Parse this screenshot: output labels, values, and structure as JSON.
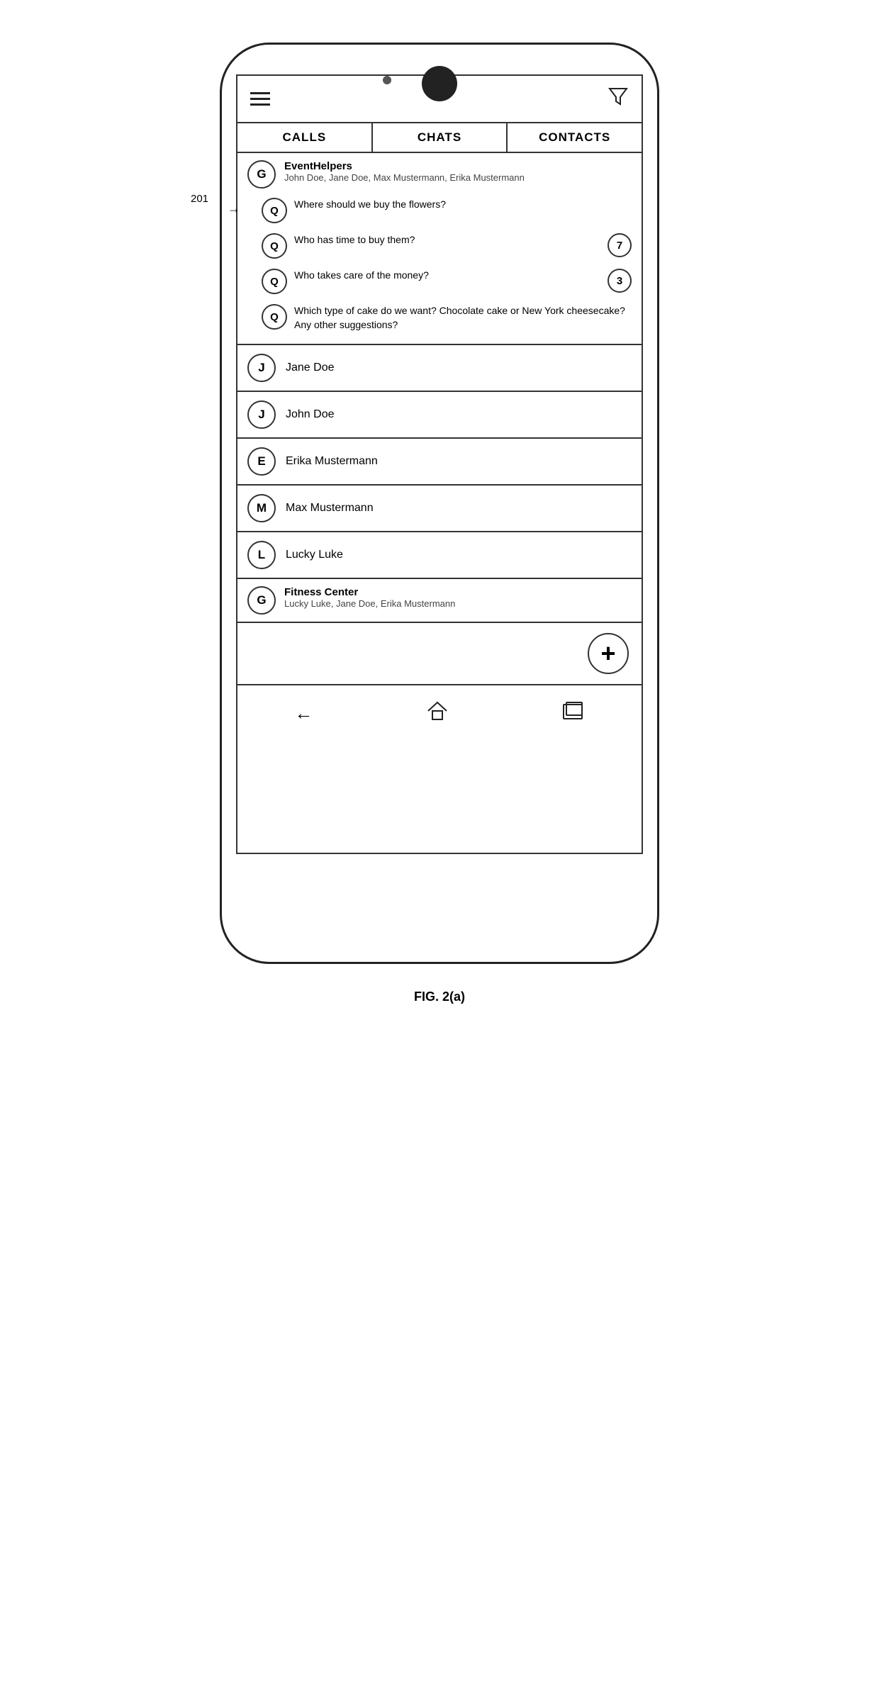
{
  "header": {
    "hamburger_label": "menu",
    "filter_label": "filter"
  },
  "tabs": [
    {
      "label": "CALLS",
      "active": false
    },
    {
      "label": "CHATS",
      "active": true
    },
    {
      "label": "CONTACTS",
      "active": false
    }
  ],
  "group_chat": {
    "avatar_letter": "G",
    "name": "EventHelpers",
    "members": "John Doe, Jane Doe, Max Mustermann, Erika Mustermann",
    "threads": [
      {
        "id": "thread-1",
        "avatar_letter": "Q",
        "message": "Where should we buy the flowers?",
        "unread": null,
        "annotation": "201"
      },
      {
        "id": "thread-2",
        "avatar_letter": "Q",
        "message": "Who has time to buy them?",
        "unread": "7"
      },
      {
        "id": "thread-3",
        "avatar_letter": "Q",
        "message": "Who takes care of the money?",
        "unread": "3"
      },
      {
        "id": "thread-4",
        "avatar_letter": "Q",
        "message": "Which type of cake do we want? Chocolate cake or New York cheesecake? Any other suggestions?",
        "unread": null
      }
    ]
  },
  "contacts": [
    {
      "avatar_letter": "J",
      "name": "Jane Doe"
    },
    {
      "avatar_letter": "J",
      "name": "John Doe"
    },
    {
      "avatar_letter": "E",
      "name": "Erika Mustermann"
    },
    {
      "avatar_letter": "M",
      "name": "Max Mustermann"
    },
    {
      "avatar_letter": "L",
      "name": "Lucky Luke"
    }
  ],
  "group_contact": {
    "avatar_letter": "G",
    "name": "Fitness Center",
    "members": "Lucky Luke, Jane Doe, Erika Mustermann"
  },
  "add_button_label": "+",
  "nav": {
    "back": "←",
    "home": "⌂",
    "recents": "▭"
  },
  "figure_caption": "FIG. 2(a)",
  "annotation_label": "201"
}
